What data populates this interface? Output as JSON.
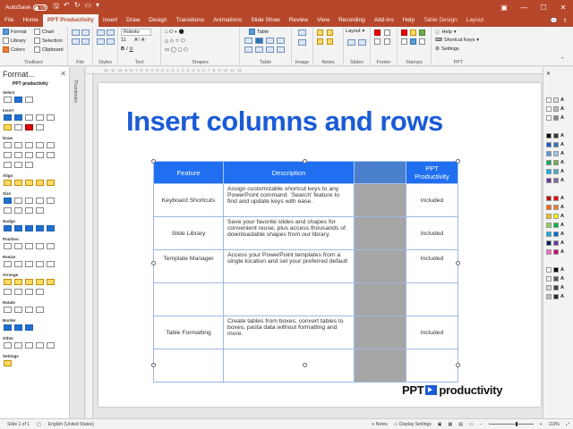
{
  "titlebar": {
    "autosave": "AutoSave",
    "toggle": "Off"
  },
  "menu": {
    "tabs": [
      "File",
      "Home",
      "PPT Productivity",
      "Insert",
      "Draw",
      "Design",
      "Transitions",
      "Animations",
      "Slide Show",
      "Review",
      "View",
      "Recording",
      "Add-ins",
      "Help"
    ],
    "context_tabs": [
      "Table Design",
      "Layout"
    ],
    "active": "PPT Productivity"
  },
  "ribbon": {
    "groups": [
      "Toolbars",
      "File",
      "Styles",
      "Text",
      "Shapes",
      "Table",
      "Image",
      "Notes",
      "Slides",
      "Footer",
      "Stamps",
      "PPT"
    ],
    "toolbars": {
      "format": "Format",
      "library": "Library",
      "colors": "Colors",
      "chart": "Chart",
      "selection": "Selection",
      "clipboard": "Clipboard"
    },
    "font_name": "Roboto",
    "font_size": "11",
    "table_label": "Table",
    "layout_label": "Layout",
    "help_label": "Help",
    "shortcut_keys": "Shortcut Keys",
    "settings_label": "Settings"
  },
  "left_panel": {
    "title": "Format...",
    "logo": "PPT productivity",
    "sections": [
      "Select",
      "Insert",
      "Draw",
      "Align",
      "Size",
      "Nudge",
      "Position",
      "Resize",
      "Arrange",
      "Rotate",
      "Border",
      "Other",
      "Settings"
    ]
  },
  "thumbnails_label": "Thumbnails",
  "ruler": "12 · 11 · 10 · 9 · 8 · 7 · 6 · 5 · 4 · 3 · 2 · 1 · 0 · 1 · 2 · 3 · 4 · 5 · 6 · 7 · 8 · 9 · 10 · 11 · 12",
  "slide": {
    "title": "Insert columns and rows",
    "table": {
      "headers": [
        "Feature",
        "Description",
        "",
        "PPT Productivity"
      ],
      "rows": [
        [
          "Keyboard Shortcuts",
          "Assign customizable shortcut keys to any PowerPoint command. 'Search' feature to find and update keys with ease.",
          "",
          "Included"
        ],
        [
          "Slide Library",
          "Save your favorite slides and shapes for convenient reuse, plus access thousands of downloadable shapes from our library.",
          "",
          "Included"
        ],
        [
          "Template Manager",
          "Access your PowerPoint templates from a single location and set your preferred default",
          "",
          "Included"
        ],
        [
          "",
          "",
          "",
          ""
        ],
        [
          "Table Formatting",
          "Create tables from boxes, convert tables to boxes, pasta data without formatting and more.",
          "",
          "Included"
        ],
        [
          "",
          "",
          "",
          ""
        ]
      ]
    },
    "logo_left": "PPT",
    "logo_right": "productivity"
  },
  "status": {
    "slide": "Slide 1 of 1",
    "language": "English (United States)",
    "notes": "Notes",
    "display": "Display Settings",
    "zoom": "110%"
  },
  "colors": {
    "accent": "#b7472a",
    "title_blue": "#1a5bd6",
    "header_blue": "#1f6ff0"
  }
}
